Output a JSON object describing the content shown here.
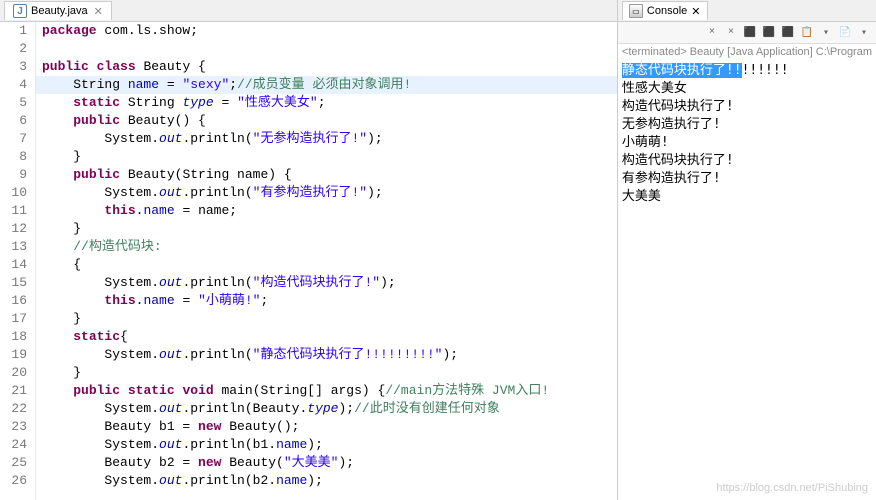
{
  "editor": {
    "tab": {
      "filename": "Beauty.java",
      "icon": "J"
    },
    "highlighted_line": 4,
    "lines": [
      {
        "n": 1,
        "seg": [
          {
            "c": "kw",
            "t": "package"
          },
          {
            "t": " com.ls.show;"
          }
        ]
      },
      {
        "n": 2,
        "seg": []
      },
      {
        "n": 3,
        "seg": [
          {
            "c": "kw",
            "t": "public"
          },
          {
            "t": " "
          },
          {
            "c": "kw",
            "t": "class"
          },
          {
            "t": " Beauty {"
          }
        ]
      },
      {
        "n": 4,
        "seg": [
          {
            "t": "    String "
          },
          {
            "c": "fld",
            "t": "name"
          },
          {
            "t": " = "
          },
          {
            "c": "str",
            "t": "\"sexy\""
          },
          {
            "t": ";"
          },
          {
            "c": "cmt",
            "t": "//成员变量 必须由对象调用!"
          }
        ]
      },
      {
        "n": 5,
        "seg": [
          {
            "t": "    "
          },
          {
            "c": "kw",
            "t": "static"
          },
          {
            "t": " String "
          },
          {
            "c": "sfld",
            "t": "type"
          },
          {
            "t": " = "
          },
          {
            "c": "str",
            "t": "\"性感大美女\""
          },
          {
            "t": ";"
          }
        ]
      },
      {
        "n": 6,
        "seg": [
          {
            "t": "    "
          },
          {
            "c": "kw",
            "t": "public"
          },
          {
            "t": " Beauty() {"
          }
        ]
      },
      {
        "n": 7,
        "seg": [
          {
            "t": "        System."
          },
          {
            "c": "sfld",
            "t": "out"
          },
          {
            "t": ".println("
          },
          {
            "c": "str",
            "t": "\"无参构造执行了!\""
          },
          {
            "t": ");"
          }
        ]
      },
      {
        "n": 8,
        "seg": [
          {
            "t": "    }"
          }
        ]
      },
      {
        "n": 9,
        "seg": [
          {
            "t": "    "
          },
          {
            "c": "kw",
            "t": "public"
          },
          {
            "t": " Beauty(String name) {"
          }
        ]
      },
      {
        "n": 10,
        "seg": [
          {
            "t": "        System."
          },
          {
            "c": "sfld",
            "t": "out"
          },
          {
            "t": ".println("
          },
          {
            "c": "str",
            "t": "\"有参构造执行了!\""
          },
          {
            "t": ");"
          }
        ]
      },
      {
        "n": 11,
        "seg": [
          {
            "t": "        "
          },
          {
            "c": "kw",
            "t": "this"
          },
          {
            "t": "."
          },
          {
            "c": "fld",
            "t": "name"
          },
          {
            "t": " = name;"
          }
        ]
      },
      {
        "n": 12,
        "seg": [
          {
            "t": "    }"
          }
        ]
      },
      {
        "n": 13,
        "seg": [
          {
            "t": "    "
          },
          {
            "c": "cmt",
            "t": "//构造代码块:"
          }
        ]
      },
      {
        "n": 14,
        "seg": [
          {
            "t": "    {"
          }
        ]
      },
      {
        "n": 15,
        "seg": [
          {
            "t": "        System."
          },
          {
            "c": "sfld",
            "t": "out"
          },
          {
            "t": ".println("
          },
          {
            "c": "str",
            "t": "\"构造代码块执行了!\""
          },
          {
            "t": ");"
          }
        ]
      },
      {
        "n": 16,
        "seg": [
          {
            "t": "        "
          },
          {
            "c": "kw",
            "t": "this"
          },
          {
            "t": "."
          },
          {
            "c": "fld",
            "t": "name"
          },
          {
            "t": " = "
          },
          {
            "c": "str",
            "t": "\"小萌萌!\""
          },
          {
            "t": ";"
          }
        ]
      },
      {
        "n": 17,
        "seg": [
          {
            "t": "    }"
          }
        ]
      },
      {
        "n": 18,
        "seg": [
          {
            "t": "    "
          },
          {
            "c": "kw",
            "t": "static"
          },
          {
            "t": "{"
          }
        ]
      },
      {
        "n": 19,
        "seg": [
          {
            "t": "        System."
          },
          {
            "c": "sfld",
            "t": "out"
          },
          {
            "t": ".println("
          },
          {
            "c": "str",
            "t": "\"静态代码块执行了!!!!!!!!!\""
          },
          {
            "t": ");"
          }
        ]
      },
      {
        "n": 20,
        "seg": [
          {
            "t": "    }"
          }
        ]
      },
      {
        "n": 21,
        "seg": [
          {
            "t": "    "
          },
          {
            "c": "kw",
            "t": "public"
          },
          {
            "t": " "
          },
          {
            "c": "kw",
            "t": "static"
          },
          {
            "t": " "
          },
          {
            "c": "kw",
            "t": "void"
          },
          {
            "t": " main(String[] args) {"
          },
          {
            "c": "cmt",
            "t": "//main方法特殊 JVM入口!"
          }
        ]
      },
      {
        "n": 22,
        "seg": [
          {
            "t": "        System."
          },
          {
            "c": "sfld",
            "t": "out"
          },
          {
            "t": ".println(Beauty."
          },
          {
            "c": "sfld",
            "t": "type"
          },
          {
            "t": ");"
          },
          {
            "c": "cmt",
            "t": "//此时没有创建任何对象"
          }
        ]
      },
      {
        "n": 23,
        "seg": [
          {
            "t": "        Beauty b1 = "
          },
          {
            "c": "kw",
            "t": "new"
          },
          {
            "t": " Beauty();"
          }
        ]
      },
      {
        "n": 24,
        "seg": [
          {
            "t": "        System."
          },
          {
            "c": "sfld",
            "t": "out"
          },
          {
            "t": ".println(b1."
          },
          {
            "c": "fld",
            "t": "name"
          },
          {
            "t": ");"
          }
        ]
      },
      {
        "n": 25,
        "seg": [
          {
            "t": "        Beauty b2 = "
          },
          {
            "c": "kw",
            "t": "new"
          },
          {
            "t": " Beauty("
          },
          {
            "c": "str",
            "t": "\"大美美\""
          },
          {
            "t": ");"
          }
        ]
      },
      {
        "n": 26,
        "seg": [
          {
            "t": "        System."
          },
          {
            "c": "sfld",
            "t": "out"
          },
          {
            "t": ".println(b2."
          },
          {
            "c": "fld",
            "t": "name"
          },
          {
            "t": ");"
          }
        ]
      }
    ]
  },
  "console": {
    "tab_label": "Console",
    "terminated": "<terminated> Beauty [Java Application] C:\\Program",
    "toolbar": [
      "×",
      "×",
      "⬛",
      "⬛",
      "⬛",
      "📋",
      "▾",
      "📄",
      "▾"
    ],
    "output": [
      {
        "sel": true,
        "t": "静态代码块执行了!!",
        "t2": "!!!!!!"
      },
      {
        "t": "性感大美女"
      },
      {
        "t": "构造代码块执行了!"
      },
      {
        "t": "无参构造执行了!"
      },
      {
        "t": "小萌萌!"
      },
      {
        "t": "构造代码块执行了!"
      },
      {
        "t": "有参构造执行了!"
      },
      {
        "t": "大美美"
      }
    ]
  },
  "watermark": "https://blog.csdn.net/PiShubing"
}
